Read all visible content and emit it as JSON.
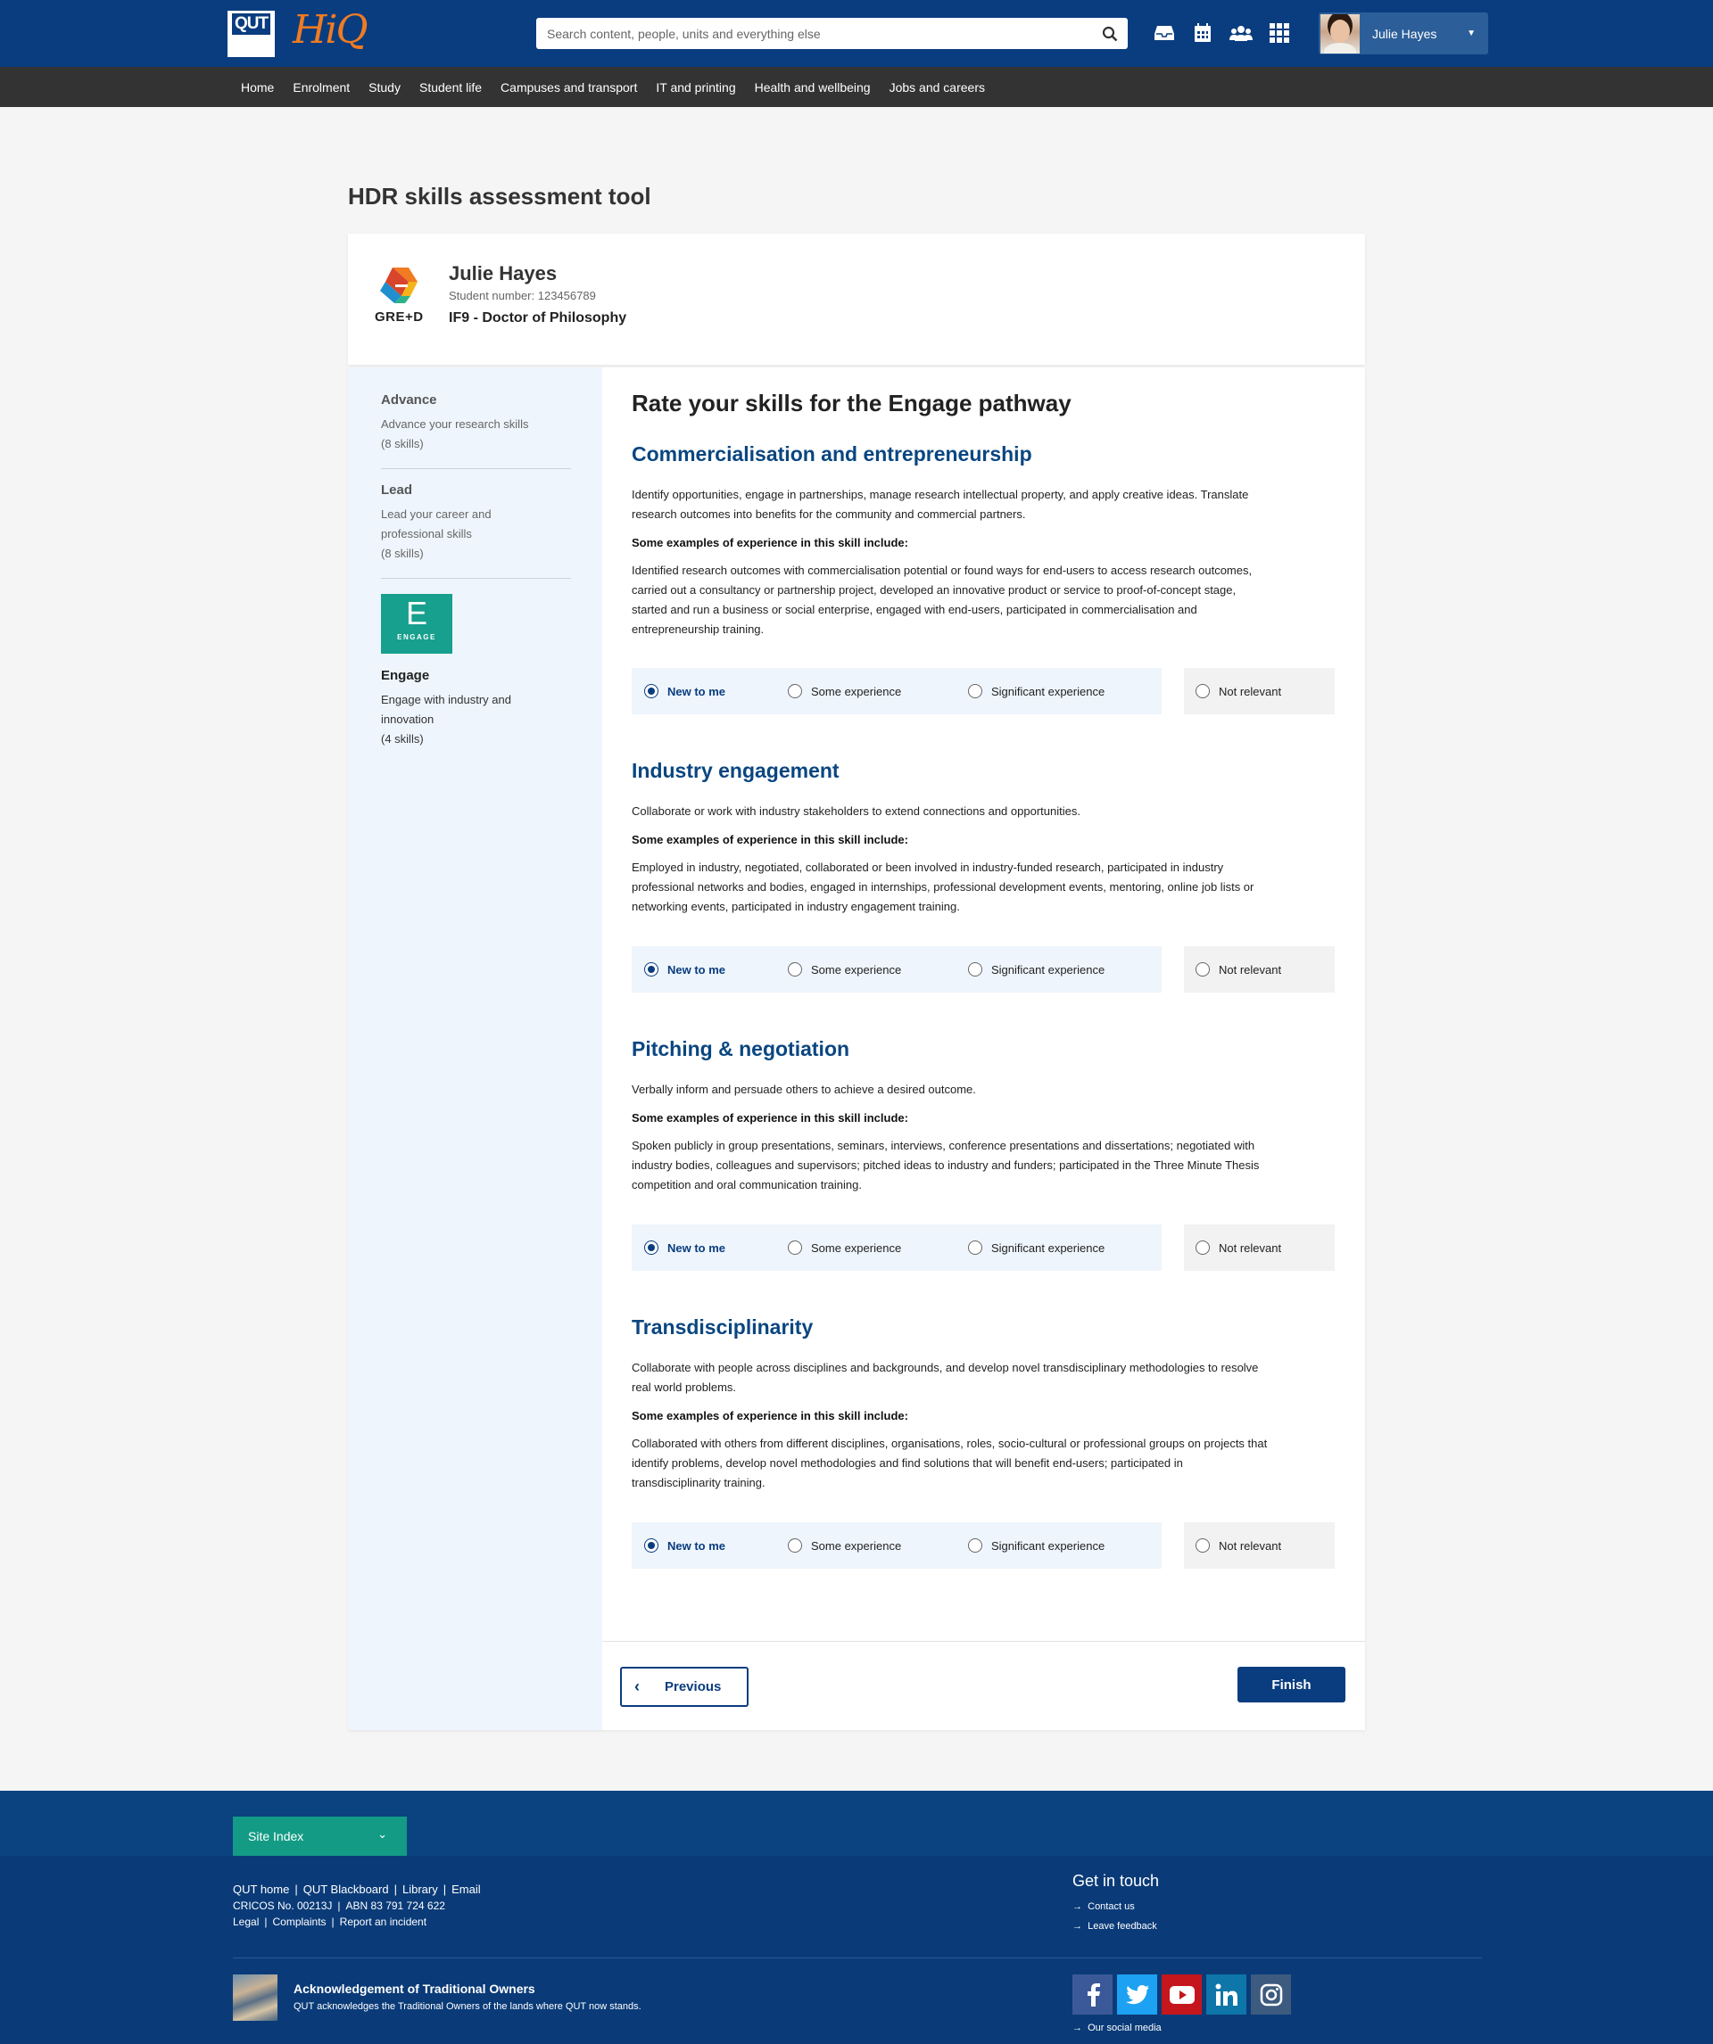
{
  "header": {
    "logo_text": "QUT",
    "app_logo_text": "HiQ",
    "search_placeholder": "Search content, people, units and everything else",
    "user_name": "Julie Hayes",
    "icons": [
      "search-icon",
      "inbox-icon",
      "calendar-icon",
      "people-icon",
      "apps-grid-icon",
      "caret-down-icon"
    ]
  },
  "nav": [
    "Home",
    "Enrolment",
    "Study",
    "Student life",
    "Campuses and transport",
    "IT and printing",
    "Health and wellbeing",
    "Jobs and careers"
  ],
  "page_title": "HDR skills assessment tool",
  "profile": {
    "logo_text": "GRE+D",
    "name": "Julie Hayes",
    "student_number": "Student number: 123456789",
    "course": "IF9 - Doctor of Philosophy"
  },
  "sidebar": [
    {
      "title": "Advance",
      "desc1": "Advance your research skills",
      "desc2": "(8 skills)"
    },
    {
      "title": "Lead",
      "desc1": "Lead your career and",
      "desc1b": "professional skills",
      "desc2": "(8 skills)"
    },
    {
      "title": "Engage",
      "desc1": "Engage with industry and",
      "desc1b": "innovation",
      "desc2": "(4 skills)",
      "badge_letter": "E",
      "badge_word": "ENGAGE",
      "badge_color": "#16a08d"
    }
  ],
  "main_heading": "Rate your skills for the Engage pathway",
  "examples_label": "Some examples of experience in this skill include:",
  "rating_options": [
    "New to me",
    "Some experience",
    "Significant experience",
    "Not relevant"
  ],
  "skills": [
    {
      "title": "Commercialisation and entrepreneurship",
      "desc_lines": [
        "Identify opportunities, engage in partnerships, manage research intellectual property, and apply creative ideas. Translate",
        "research outcomes into benefits for the community and commercial partners."
      ],
      "example_lines": [
        "Identified research outcomes with commercialisation potential or found ways for end-users to access research outcomes,",
        "carried out a consultancy or partnership project, developed an innovative product or service to proof-of-concept stage,",
        "started and run a business or social enterprise, engaged with end-users, participated in commercialisation and",
        "entrepreneurship training."
      ],
      "selected": "New to me"
    },
    {
      "title": "Industry engagement",
      "desc_lines": [
        "Collaborate or work with industry stakeholders to extend connections and opportunities."
      ],
      "example_lines": [
        "Employed in industry, negotiated, collaborated or been involved in industry-funded research, participated in industry",
        "professional networks and bodies, engaged in internships, professional development events, mentoring, online job lists or",
        "networking events, participated in industry engagement training."
      ],
      "selected": "New to me"
    },
    {
      "title": "Pitching & negotiation",
      "desc_lines": [
        "Verbally inform and persuade others to achieve a desired outcome."
      ],
      "example_lines": [
        "Spoken publicly in group presentations, seminars, interviews, conference presentations and dissertations; negotiated with",
        "industry bodies, colleagues and supervisors; pitched ideas to industry and funders; participated in the Three Minute Thesis",
        "competition and oral communication training."
      ],
      "selected": "New to me"
    },
    {
      "title": "Transdisciplinarity",
      "desc_lines": [
        "Collaborate with people across disciplines and backgrounds, and develop novel transdisciplinary methodologies to resolve",
        "real world problems."
      ],
      "example_lines": [
        "Collaborated with others from different disciplines, organisations, roles, socio-cultural or professional groups on projects that",
        "identify problems, develop novel methodologies and find solutions that will benefit end-users; participated in",
        "transdisciplinarity training."
      ],
      "selected": "New to me"
    }
  ],
  "buttons": {
    "previous": "Previous",
    "finish": "Finish"
  },
  "footer": {
    "site_index": "Site Index",
    "links_row1": [
      "QUT home",
      "QUT Blackboard",
      "Library",
      "Email"
    ],
    "cricos": "CRICOS No. 00213J",
    "abn": "ABN 83 791 724 622",
    "links_row3": [
      "Legal",
      "Complaints",
      "Report an incident"
    ],
    "get_in_touch": "Get in touch",
    "contact": [
      "Contact us",
      "Leave feedback"
    ],
    "ack_title": "Acknowledgement of Traditional Owners",
    "ack_text": "QUT acknowledges the Traditional Owners of the lands where QUT now stands.",
    "social_icons": [
      "facebook-icon",
      "twitter-icon",
      "youtube-icon",
      "linkedin-icon",
      "instagram-icon"
    ],
    "our_social": "Our social media"
  },
  "colors": {
    "brand_navy": "#0a3d7f",
    "accent_orange": "#f07b22",
    "accent_teal": "#139b85"
  }
}
